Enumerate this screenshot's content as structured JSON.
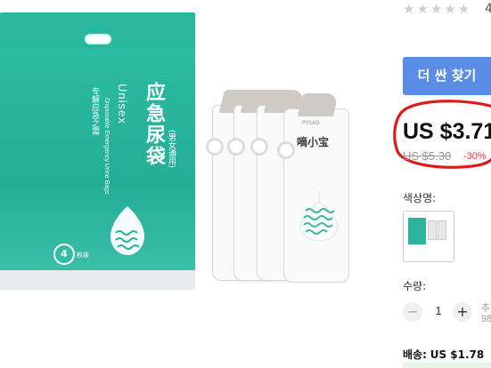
{
  "product_image": {
    "pouch": {
      "title": "应急尿袋",
      "subtitle": "(男女通用)",
      "unisex": "Unisex",
      "english_line": "Disposable Emergency Urine Bags",
      "tagline": "专解应急之需",
      "count": "4",
      "count_label": "枚装"
    },
    "bag": {
      "brand": "PYSAD",
      "name": "嘀小宝"
    },
    "colors": {
      "teal": "#29b79f",
      "bag": "#fafafa",
      "spout": "#cfcac4"
    }
  },
  "rating": {
    "stars": [
      "★",
      "★",
      "★",
      "★",
      "★"
    ],
    "review_count": "4"
  },
  "coupon_button": {
    "label": "더 싼 찾기",
    "color": "#5a8ee6"
  },
  "price": {
    "current": "US $3.71",
    "original": "US $5.30",
    "discount": "-30%",
    "discount_color": "#e8333a",
    "highlight_color": "#e01a1a"
  },
  "color_option": {
    "label": "색상명:"
  },
  "quantity": {
    "label": "수량:",
    "minus": "−",
    "value": "1",
    "plus": "+",
    "stock_line1": "추",
    "stock_line2": "98"
  },
  "shipping": {
    "label": "배송:",
    "value": "US $1.78"
  }
}
